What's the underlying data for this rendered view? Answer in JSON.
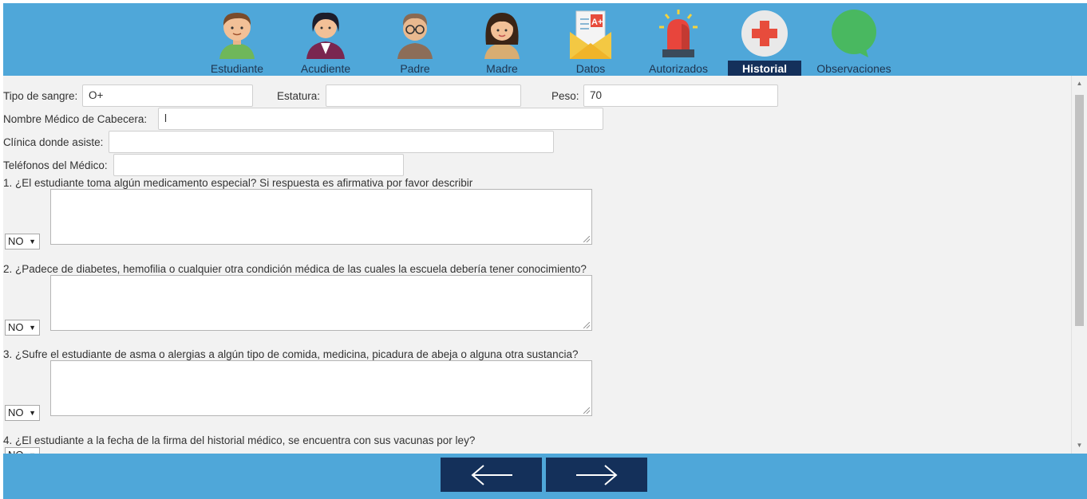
{
  "nav": {
    "items": [
      {
        "label": "Estudiante",
        "icon": "student-avatar-icon"
      },
      {
        "label": "Acudiente",
        "icon": "guardian-avatar-icon"
      },
      {
        "label": "Padre",
        "icon": "father-avatar-icon"
      },
      {
        "label": "Madre",
        "icon": "mother-avatar-icon"
      },
      {
        "label": "Datos",
        "icon": "grade-envelope-icon"
      },
      {
        "label": "Autorizados",
        "icon": "siren-icon"
      },
      {
        "label": "Historial",
        "icon": "medical-cross-icon",
        "active": true
      },
      {
        "label": "Observaciones",
        "icon": "chat-bubble-icon"
      }
    ]
  },
  "form": {
    "blood_type_label": "Tipo de sangre:",
    "blood_type_value": "O+",
    "height_label": "Estatura:",
    "height_value": "",
    "weight_label": "Peso:",
    "weight_value": "70",
    "doctor_name_label": "Nombre Médico de Cabecera:",
    "doctor_name_value": "l",
    "clinic_label": "Clínica donde asiste:",
    "clinic_value": "",
    "doctor_phone_label": "Teléfonos del Médico:",
    "doctor_phone_value": ""
  },
  "questions": [
    {
      "text": "1. ¿El estudiante toma algún medicamento especial? Si respuesta es afirmativa por favor describir",
      "answer": "NO"
    },
    {
      "text": "2. ¿Padece de diabetes, hemofilia o cualquier otra condición médica de las cuales la escuela debería tener conocimiento?",
      "answer": "NO"
    },
    {
      "text": "3. ¿Sufre el estudiante de asma o alergias a algún tipo de comida, medicina, picadura de abeja o alguna otra sustancia?",
      "answer": "NO"
    },
    {
      "text": "4. ¿El estudiante a la fecha de la firma del historial médico, se encuentra con sus vacunas por ley?",
      "answer": "NO"
    }
  ],
  "colors": {
    "nav_background": "#4fa7d9",
    "active_tab": "#14305a",
    "form_background": "#f2f2f2",
    "arrow_button": "#14305a"
  },
  "footer": {
    "prev_icon": "arrow-left-icon",
    "next_icon": "arrow-right-icon"
  }
}
